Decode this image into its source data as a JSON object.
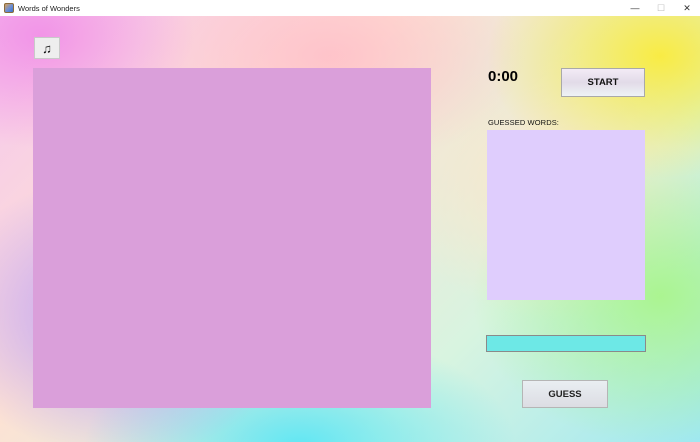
{
  "window": {
    "title": "Words of Wonders",
    "app_icon": "app-icon",
    "minimize_glyph": "—",
    "maximize_glyph": "☐",
    "close_glyph": "✕"
  },
  "music_button": {
    "icon": "music-note-icon",
    "glyph": "♫"
  },
  "timer": {
    "value": "0:00"
  },
  "start_button": {
    "label": "START"
  },
  "guessed_words": {
    "label": "GUESSED WORDS:",
    "items": []
  },
  "guess_input": {
    "value": "",
    "placeholder": ""
  },
  "guess_button": {
    "label": "GUESS"
  },
  "colors": {
    "board": "#da9fda",
    "guessed_list": "#dfcdfd",
    "guess_input": "#6de8e6"
  }
}
